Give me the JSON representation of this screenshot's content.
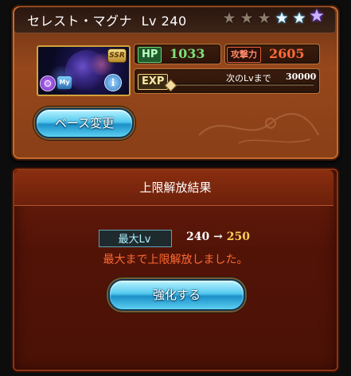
{
  "character": {
    "name": "セレスト・マグナ",
    "level_label": "Lv",
    "level": "240",
    "rarity_badge": "SSR",
    "type_badge": "My",
    "stars": [
      "bronze",
      "bronze",
      "bronze",
      "blue",
      "blue",
      "purple"
    ]
  },
  "stats": {
    "hp_label": "HP",
    "hp_value": "1033",
    "atk_label": "攻撃力",
    "atk_value": "2605",
    "exp_label": "EXP",
    "next_lv_label": "次のLvまで",
    "next_lv_value": "30000",
    "exp_progress": 0
  },
  "buttons": {
    "base_change": "ベース変更",
    "enhance": "強化する"
  },
  "result": {
    "title": "上限解放結果",
    "max_lv_label": "最大Lv",
    "old_lv": "240",
    "arrow": "→",
    "new_lv": "250",
    "message": "最大まで上限解放しました。"
  },
  "colors": {
    "card_brown": "#8a3f17",
    "panel_red": "#521307",
    "hp_green": "#7ee07a",
    "atk_orange": "#ff6a3a",
    "button_blue": "#55c9ee",
    "message_orange": "#ff6a32",
    "new_lv_gold": "#ffcf57"
  }
}
